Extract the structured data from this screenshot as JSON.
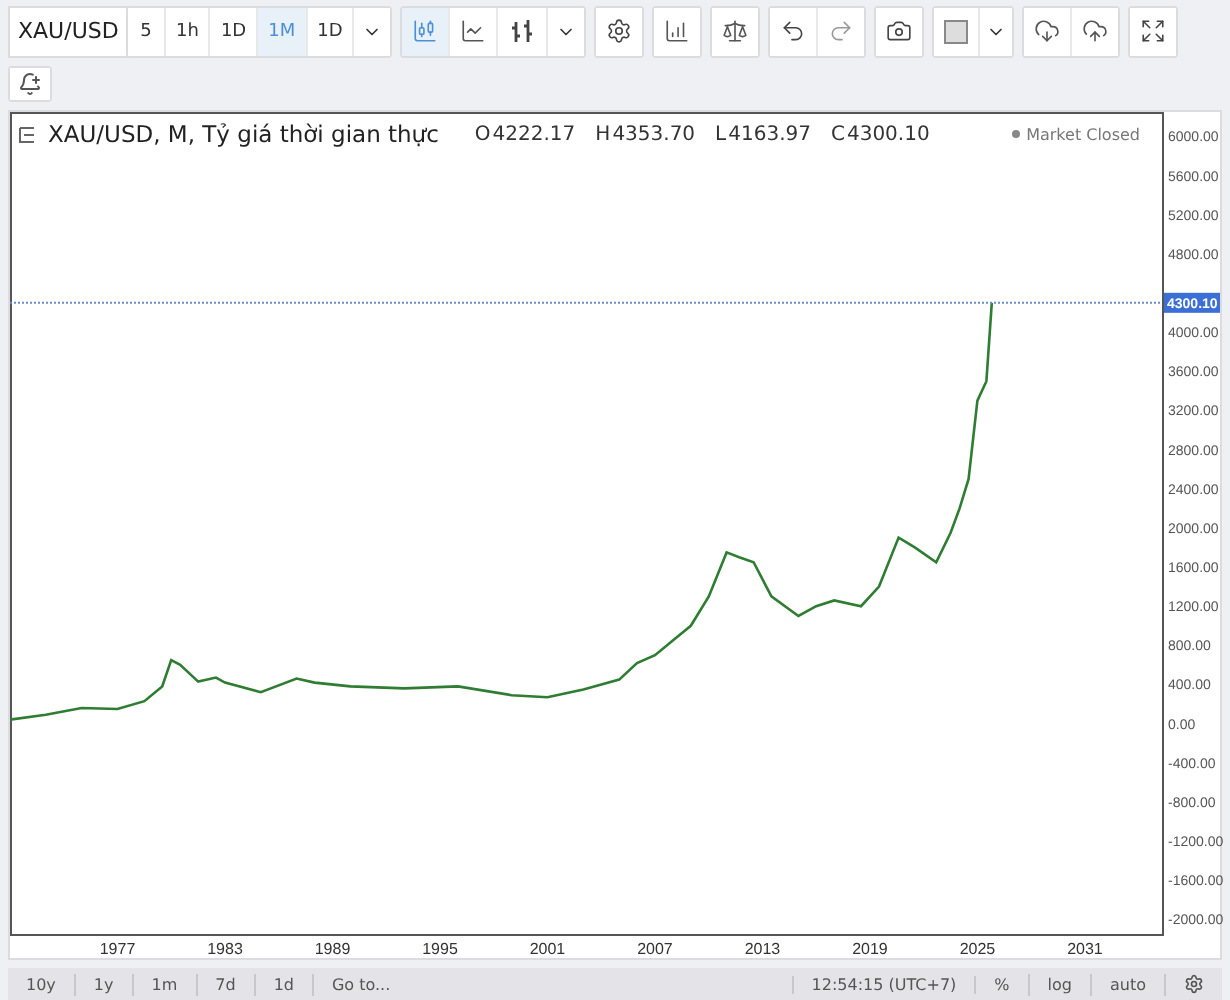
{
  "toolbar": {
    "symbol": "XAU/USD",
    "intervals": [
      {
        "label": "5",
        "selected": false
      },
      {
        "label": "1h",
        "selected": false
      },
      {
        "label": "1D",
        "selected": false
      },
      {
        "label": "1M",
        "selected": true
      },
      {
        "label": "1D",
        "selected": false
      }
    ],
    "chart_styles": [
      {
        "kind": "candles",
        "selected": true
      },
      {
        "kind": "line",
        "selected": false
      },
      {
        "kind": "bars",
        "selected": false
      }
    ]
  },
  "legend": {
    "title": "XAU/USD, M, Tỷ giá thời gian thực",
    "ohlc": [
      {
        "label": "O",
        "value": "4222.17"
      },
      {
        "label": "H",
        "value": "4353.70"
      },
      {
        "label": "L",
        "value": "4163.97"
      },
      {
        "label": "C",
        "value": "4300.10"
      }
    ],
    "status": "Market Closed"
  },
  "chart": {
    "chart_data": {
      "type": "line",
      "x": [
        1971,
        1973,
        1975,
        1977,
        1978.5,
        1979.5,
        1980,
        1980.5,
        1981.5,
        1982.5,
        1983,
        1985,
        1987,
        1988,
        1990,
        1993,
        1996,
        1999,
        2001,
        2003,
        2005,
        2006,
        2007,
        2008,
        2009,
        2010,
        2011,
        2011.7,
        2012.5,
        2013.5,
        2015,
        2016,
        2017,
        2018.5,
        2019.5,
        2020.6,
        2021.5,
        2022.7,
        2023.5,
        2024,
        2024.5,
        2025,
        2025.5,
        2025.8
      ],
      "series": [
        {
          "color": "#2e7d32",
          "values": [
            40,
            90,
            160,
            150,
            230,
            380,
            650,
            600,
            430,
            470,
            420,
            320,
            460,
            420,
            380,
            360,
            380,
            290,
            270,
            350,
            450,
            620,
            700,
            850,
            1000,
            1300,
            1750,
            1700,
            1650,
            1300,
            1100,
            1200,
            1260,
            1200,
            1400,
            1900,
            1800,
            1650,
            1950,
            2200,
            2500,
            3300,
            3500,
            4300
          ]
        }
      ],
      "xlim": [
        1971,
        2035.3
      ],
      "ylim": [
        -2150,
        6250
      ],
      "ref_lines": [
        {
          "axis": "y",
          "value": 4300.1,
          "label": "4300.10"
        }
      ],
      "xticks": [
        1977,
        1983,
        1989,
        1995,
        2001,
        2007,
        2013,
        2019,
        2025,
        2031
      ],
      "yticks": [
        {
          "value": 6000,
          "label": "6000.00"
        },
        {
          "value": 5600,
          "label": "5600.00"
        },
        {
          "value": 5200,
          "label": "5200.00"
        },
        {
          "value": 4800,
          "label": "4800.00"
        },
        {
          "value": 4000,
          "label": "4000.00"
        },
        {
          "value": 3600,
          "label": "3600.00"
        },
        {
          "value": 3200,
          "label": "3200.00"
        },
        {
          "value": 2800,
          "label": "2800.00"
        },
        {
          "value": 2400,
          "label": "2400.00"
        },
        {
          "value": 2000,
          "label": "2000.00"
        },
        {
          "value": 1600,
          "label": "1600.00"
        },
        {
          "value": 1200,
          "label": "1200.00"
        },
        {
          "value": 800,
          "label": "800.00"
        },
        {
          "value": 400,
          "label": "400.00"
        },
        {
          "value": 0,
          "label": "0.00"
        },
        {
          "value": -400,
          "label": "-400.00"
        },
        {
          "value": -800,
          "label": "-800.00"
        },
        {
          "value": -1200,
          "label": "-1200.00"
        },
        {
          "value": -1600,
          "label": "-1600.00"
        },
        {
          "value": -2000,
          "label": "-2000.00"
        }
      ]
    }
  },
  "footer": {
    "ranges": [
      "10y",
      "1y",
      "1m",
      "7d",
      "1d"
    ],
    "goto": "Go to...",
    "time": "12:54:15 (UTC+7)",
    "options": [
      "%",
      "log",
      "auto"
    ]
  }
}
